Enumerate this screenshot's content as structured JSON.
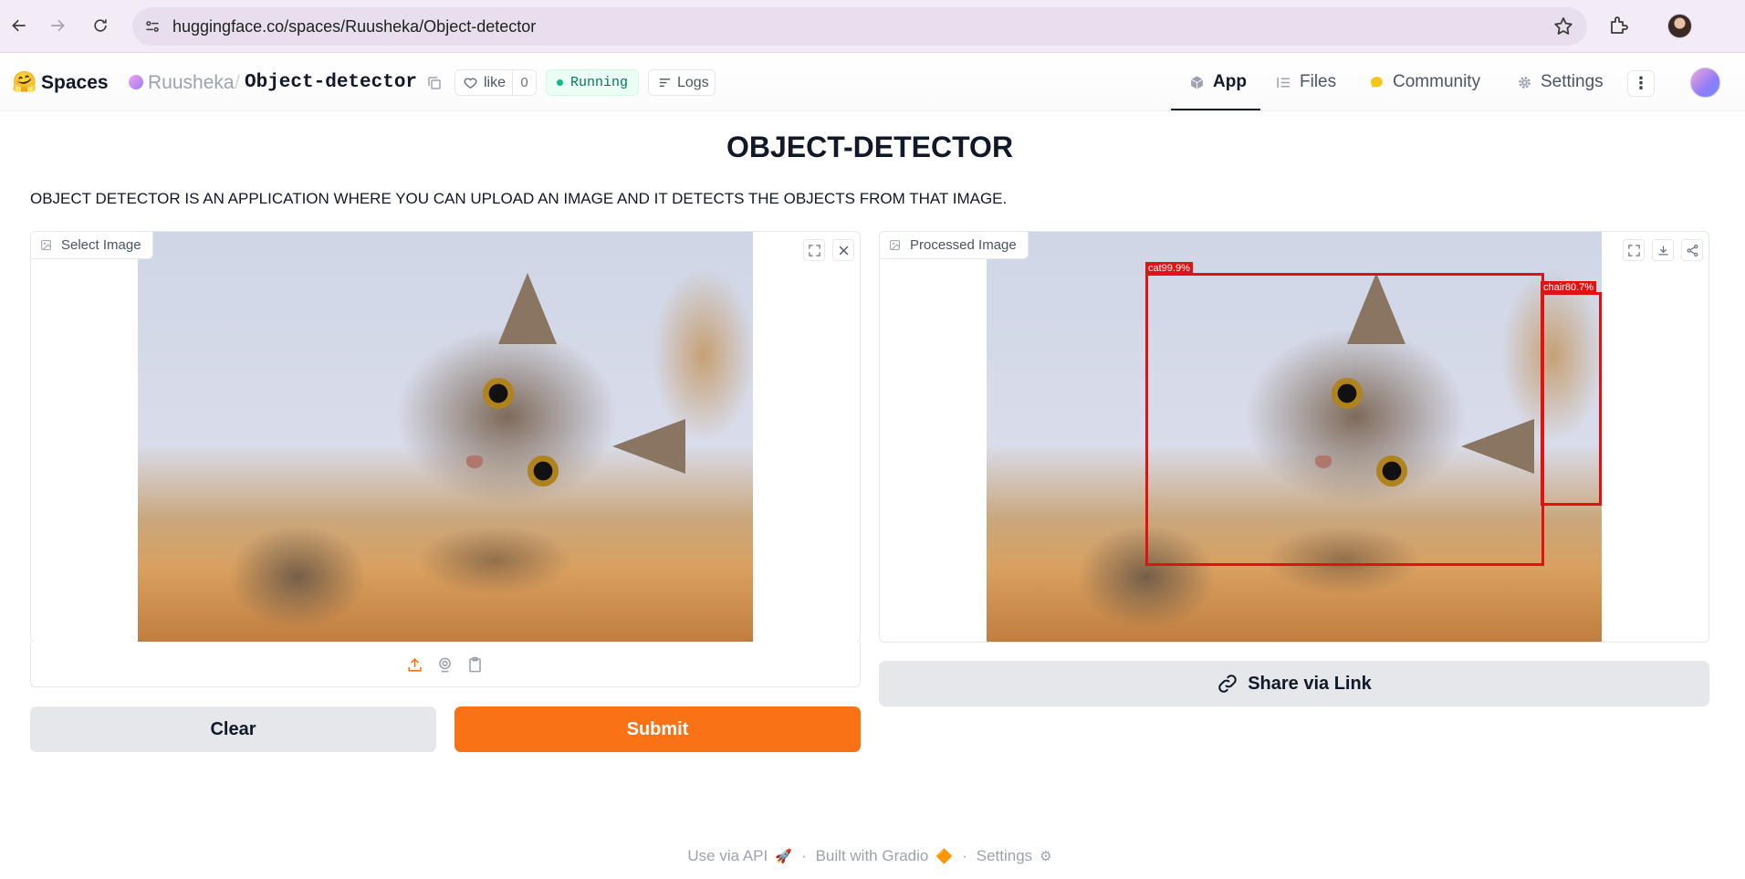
{
  "browser": {
    "url": "huggingface.co/spaces/Ruusheka/Object-detector"
  },
  "header": {
    "logo_emoji": "🤗",
    "spaces_label": "Spaces",
    "owner": "Ruusheka",
    "separator": "/",
    "repo": "Object-detector",
    "like_label": "like",
    "like_count": "0",
    "status": "Running",
    "logs_label": "Logs",
    "tabs": [
      {
        "label": "App",
        "icon": "cube-icon",
        "active": true
      },
      {
        "label": "Files",
        "icon": "files-icon",
        "active": false
      },
      {
        "label": "Community",
        "icon": "community-icon",
        "active": false
      },
      {
        "label": "Settings",
        "icon": "gear-icon",
        "active": false
      }
    ],
    "more_label": "⋮"
  },
  "app": {
    "title": "OBJECT-DETECTOR",
    "description": "OBJECT DETECTOR IS AN APPLICATION WHERE YOU CAN UPLOAD AN IMAGE AND IT DETECTS THE OBJECTS FROM THAT IMAGE.",
    "input_panel": {
      "label": "Select Image",
      "sources": [
        "upload-icon",
        "webcam-icon",
        "clipboard-icon"
      ]
    },
    "output_panel": {
      "label": "Processed Image",
      "detections": [
        {
          "label": "cat99.9%",
          "class": "cat",
          "confidence": 0.999
        },
        {
          "label": "chair80.7%",
          "class": "chair",
          "confidence": 0.807
        }
      ]
    },
    "buttons": {
      "clear": "Clear",
      "submit": "Submit",
      "share": "Share via Link"
    },
    "colors": {
      "primary": "#f97316",
      "secondary": "#e5e7eb",
      "box": "#e31212",
      "status": "#10b981"
    }
  },
  "footer": {
    "api": "Use via API",
    "api_icon": "🚀",
    "gradio": "Built with Gradio",
    "gradio_icon": "🔶",
    "settings": "Settings",
    "settings_icon": "⚙"
  }
}
